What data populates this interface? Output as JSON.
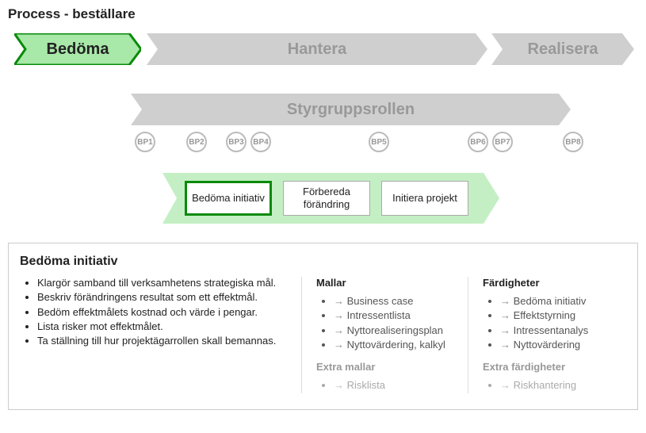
{
  "title": "Process - beställare",
  "main_phases": [
    {
      "label": "Bedöma",
      "active": true
    },
    {
      "label": "Hantera",
      "active": false
    },
    {
      "label": "Realisera",
      "active": false
    }
  ],
  "secondary_role": "Styrgruppsrollen",
  "bp_points": [
    "BP1",
    "BP2",
    "BP3",
    "BP4",
    "BP5",
    "BP6",
    "BP7",
    "BP8"
  ],
  "sub_steps": [
    {
      "label": "Bedöma initiativ",
      "active": true
    },
    {
      "label": "Förbereda förändring",
      "active": false
    },
    {
      "label": "Initiera projekt",
      "active": false
    }
  ],
  "detail": {
    "heading": "Bedöma initiativ",
    "bullets": [
      "Klargör samband till verksamhetens strategiska mål.",
      "Beskriv förändringens resultat som ett effektmål.",
      "Bedöm effektmålets kostnad och värde i pengar.",
      "Lista risker mot effektmålet.",
      "Ta ställning till hur projektägarrollen skall bemannas."
    ],
    "templates": {
      "heading": "Mallar",
      "items": [
        "Business case",
        "Intressentlista",
        "Nyttorealiseringsplan",
        "Nyttovärdering, kalkyl"
      ],
      "extra_heading": "Extra mallar",
      "extra_items": [
        "Risklista"
      ]
    },
    "skills": {
      "heading": "Färdigheter",
      "items": [
        "Bedöma initiativ",
        "Effektstyrning",
        "Intressentanalys",
        "Nyttovärdering"
      ],
      "extra_heading": "Extra färdigheter",
      "extra_items": [
        "Riskhantering"
      ]
    }
  }
}
